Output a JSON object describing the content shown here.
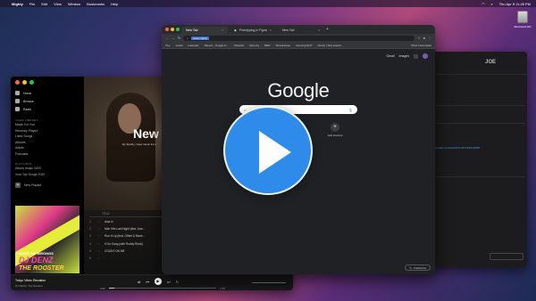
{
  "menubar": {
    "apple": "",
    "app": "Mighty",
    "menus": [
      "File",
      "Edit",
      "View",
      "Window",
      "Bookmarks",
      "Help"
    ],
    "clock": "Thu Apr 8 11:28 PM"
  },
  "desktop": {
    "disk_label": "Macintosh HD"
  },
  "spotify": {
    "nav": [
      "Home",
      "Browse",
      "Radio"
    ],
    "library_header": "YOUR LIBRARY",
    "library": [
      "Made For You",
      "Recently Played",
      "Liked Songs",
      "Albums",
      "Artists",
      "Podcasts"
    ],
    "playlists_header": "PLAYLISTS",
    "playlists": [
      "Album music 2020",
      "Your Top Songs 2020"
    ],
    "new_playlist": "New Playlist",
    "cover": {
      "line1": "EIGHT MY WRONGS",
      "line2": "DJ DENZ",
      "line3": "THE ROOSTER"
    },
    "hero": {
      "title": "New",
      "subtitle": "By Spotify • New music from"
    },
    "tracks_header": "TITLE",
    "tracks": [
      {
        "num": "1",
        "title": "Asia in"
      },
      {
        "num": "2",
        "title": "Man Hits Last Night (feat. Ana..."
      },
      {
        "num": "3",
        "title": "Run It Up (feat. Offset & Mone..."
      },
      {
        "num": "4",
        "title": "If Da Gang (with Roddy Ricch)"
      },
      {
        "num": "5",
        "title": "COUNT ON ME"
      },
      {
        "num": "6",
        "title": ""
      }
    ],
    "player": {
      "track": "Tokyo Vibes Elevation",
      "artist": "DJ DENZ, The Rooster",
      "elapsed": "0:05",
      "duration": "2:55",
      "progress": 0.05
    }
  },
  "chrome": {
    "tabs": [
      {
        "label": "New Tab",
        "active": true
      },
      {
        "label": "Prototyping in Figma - Figma...",
        "active": false
      },
      {
        "label": "New Tab",
        "active": false
      }
    ],
    "omnibox_value": "www.mighty",
    "bookmarks": [
      "Tiny",
      "Gmail",
      "Calendar",
      "Recent - Google D...",
      "Weather",
      "Mercury",
      "BDD",
      "StreetHouse",
      "Opening EUP",
      "Notion | Doc search..."
    ],
    "other_bookmarks": "Other bookmarks",
    "top_links": [
      "Gmail",
      "Images"
    ],
    "logo": "Google",
    "search_placeholder": "Search Google or type a URL",
    "shortcuts": [
      {
        "label": "",
        "icon": "M"
      },
      {
        "label": "Add shortcut",
        "icon": "+"
      }
    ],
    "customize": "Customize"
  },
  "right_window": {
    "logo": "JOE",
    "link": "https://www.youtube.com/watch?v=9YCSP3J2Wf8"
  },
  "colors": {
    "play_overlay": "#2e8bea",
    "spotify_bg": "#121212",
    "chrome_bg": "#202124"
  }
}
